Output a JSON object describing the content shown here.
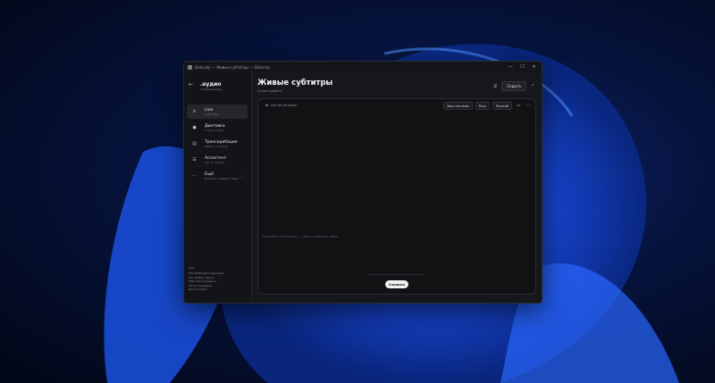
{
  "window": {
    "title": "Dotlucky — Живые субтитры — Dotlucky"
  },
  "sidebar": {
    "brand_title": ".аудио",
    "brand_subtitle": "локальная речь",
    "items": [
      {
        "label": "Live",
        "sub": "Субтитры",
        "icon": "wave-icon"
      },
      {
        "label": "Диктовка",
        "sub": "Голос в текст",
        "icon": "mic-icon"
      },
      {
        "label": "Транскрибация",
        "sub": "Файлы → тексты",
        "icon": "document-icon"
      },
      {
        "label": "Ассистент",
        "sub": "Чат по записи",
        "icon": "chat-icon"
      },
      {
        "label": "Ещё",
        "sub": "История, модели, темы",
        "icon": "more-icon"
      }
    ],
    "shortcuts_title": "HINT",
    "shortcuts": [
      "Ctrl+Shift+Space диктовка",
      "Ctrl+Shift+L запуск",
      "Shift+Alt+S вставить",
      "Ctrl+1..5 разделы",
      "Esc  в историю"
    ]
  },
  "main": {
    "title": "Живые субтитры",
    "status": "Готов к работе",
    "hide_label": "Скрыть"
  },
  "panel": {
    "live_status": "Live не запущен",
    "chips": [
      "Звук системы",
      "Речь",
      "Русский"
    ],
    "hint": "Нажмите «Слушать» — речь появится здесь",
    "listen_label": "Слушать"
  },
  "colors": {
    "accent_wallpaper": "#1a4fe0",
    "window_bg": "#16171a",
    "panel_bg": "#111214",
    "button_light": "#f1f2f4"
  }
}
